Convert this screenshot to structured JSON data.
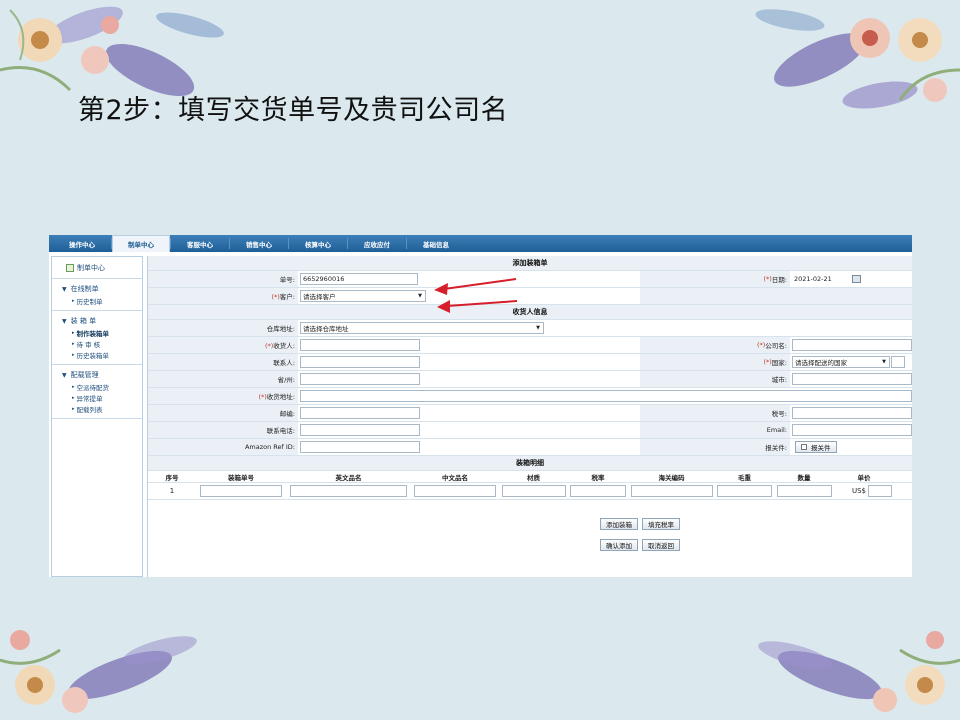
{
  "slide": {
    "title": "第2步：填写交货单号及贵司公司名"
  },
  "nav": {
    "tabs": [
      "操作中心",
      "制单中心",
      "客服中心",
      "销售中心",
      "核算中心",
      "应收应付",
      "基础信息"
    ],
    "active_index": 1
  },
  "sidebar": {
    "header": "制单中心",
    "groups": [
      {
        "title": "在线制单",
        "items": [
          "历史制单"
        ]
      },
      {
        "title": "装 箱 单",
        "items": [
          "制作装箱单",
          "待 审 核",
          "历史装箱单"
        ]
      },
      {
        "title": "配载管理",
        "items": [
          "空派待配货",
          "异常提单",
          "配载列表"
        ]
      }
    ]
  },
  "form": {
    "title": "添加装箱单",
    "order_no_label": "单号:",
    "order_no_value": "6652960016",
    "date_label": "日期:",
    "date_value": "2021-02-21",
    "customer_label": "客户:",
    "customer_value": "请选择客户",
    "req_mark": "(*)"
  },
  "receiver": {
    "title": "收货人信息",
    "warehouse_label": "仓库地址:",
    "warehouse_value": "请选择仓库地址",
    "consignee_label": "收货人:",
    "company_label": "公司名:",
    "contact_label": "联系人:",
    "country_label": "国家:",
    "country_value": "请选择配送的国家",
    "state_label": "省/州:",
    "city_label": "城市:",
    "address_label": "收货地址:",
    "postcode_label": "邮编:",
    "tax_label": "税号:",
    "phone_label": "联系电话:",
    "email_label": "Email:",
    "amazon_label": "Amazon Ref ID:",
    "customs_label": "报关件:",
    "customs_checkbox": "报关件"
  },
  "detail": {
    "title": "装箱明细",
    "columns": [
      "序号",
      "装箱单号",
      "英文品名",
      "中文品名",
      "材质",
      "税率",
      "海关编码",
      "毛重",
      "数量",
      "单价"
    ],
    "rows": [
      {
        "index": "1",
        "currency": "US$"
      }
    ]
  },
  "buttons": {
    "add_box": "添加装箱",
    "fill_tax": "填充税率",
    "confirm": "确认添加",
    "cancel": "取消返回"
  },
  "colors": {
    "nav_bg": "#1f5f97",
    "annotation_arrow": "#d61f2a",
    "slide_bg": "#dbe9ee"
  }
}
